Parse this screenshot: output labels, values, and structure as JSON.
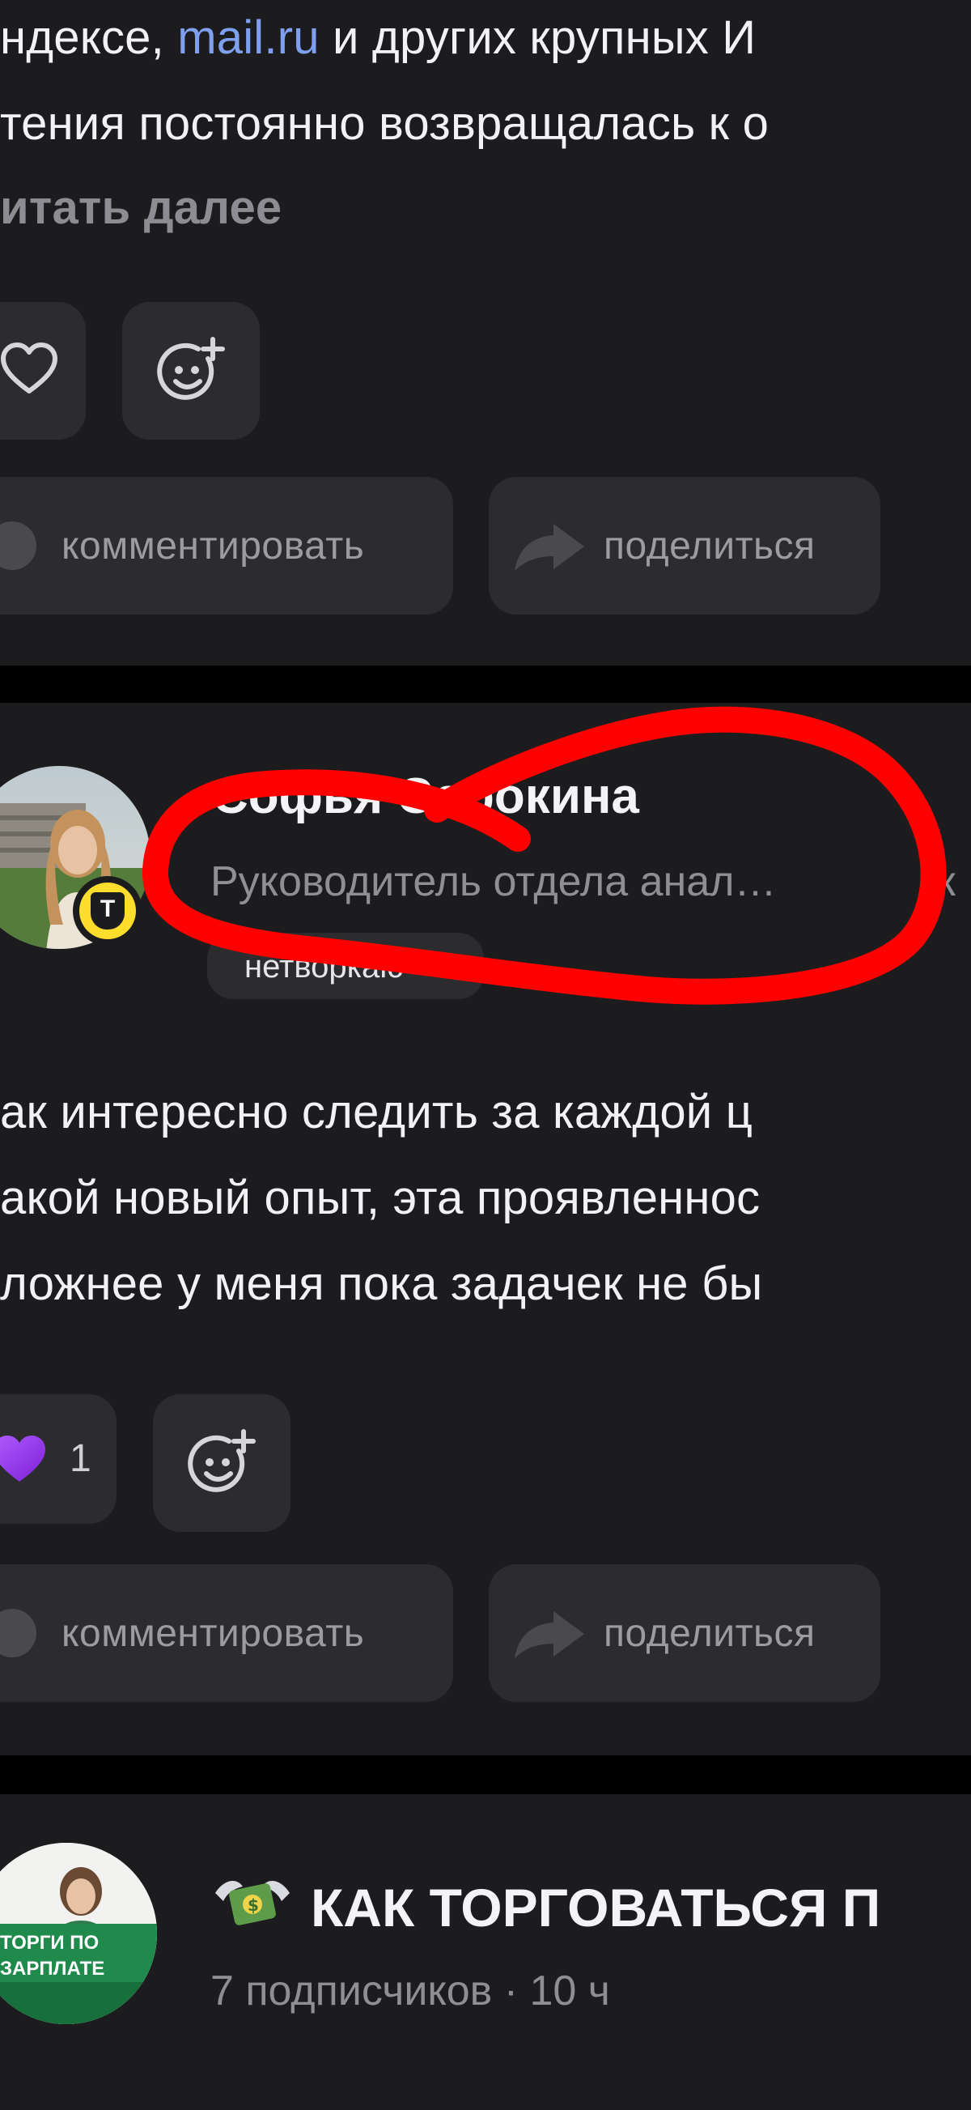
{
  "post1": {
    "line1_before": "ндексе, ",
    "line1_link": "mail.ru",
    "line1_after": " и других крупных И",
    "line2": "тения постоянно возвращалась к о",
    "read_more": "итать далее",
    "comment_label": "комментировать",
    "share_label": "поделиться"
  },
  "post2": {
    "author_name": "Софья Сорокина",
    "author_role": "Руководитель отдела анал…",
    "role_suffix": "к",
    "tag": "нетворкаю",
    "avatar_badge": "T",
    "line1": "ак интересно следить за каждой ц",
    "line2": "акой новый опыт, эта проявленнос",
    "line3": "ложнее у меня пока задачек не бы",
    "like_count": "1",
    "comment_label": "комментировать",
    "share_label": "поделиться"
  },
  "post3": {
    "title": "КАК ТОРГОВАТЬСЯ П",
    "meta": "7 подписчиков · 10 ч",
    "avatar_text_line1": "ТОРГИ ПО",
    "avatar_text_line2": "ЗАРПЛАТЕ"
  },
  "colors": {
    "background": "#000000",
    "card": "#1c1c1e",
    "button": "#2c2c2e",
    "link": "#7ea0ee",
    "annotation": "#ff0000",
    "heart_filled": "#8e2de2"
  }
}
